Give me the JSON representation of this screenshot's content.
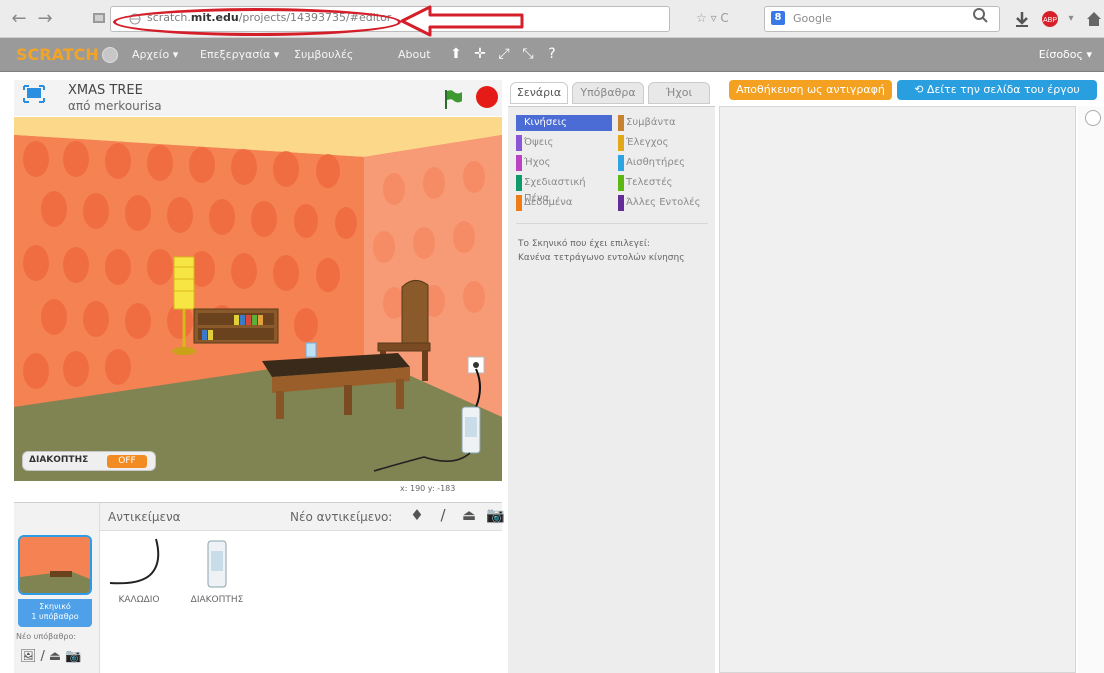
{
  "browser": {
    "url_prefix": "scratch.",
    "url_domain": "mit.edu",
    "url_suffix": "/projects/14393735/#editor",
    "search_engine": "Google"
  },
  "menubar": {
    "logo": "SCRATCH",
    "items": [
      "Αρχείο ▾",
      "Επεξεργασία ▾",
      "Συμβουλές",
      "About"
    ],
    "login": "Είσοδος ▾"
  },
  "stage": {
    "title": "XMAS TREE",
    "author": "από merkourisa",
    "variable_label": "ΔΙΑΚΟΠΤΗΣ",
    "variable_value": "OFF",
    "coords": "x: 190  y: -183"
  },
  "sprites": {
    "title": "Αντικείμενα",
    "new_sprite_label": "Νέο αντικείμενο:",
    "stage_thumb_label": "Σκηνικό\n1 υπόβαθρο",
    "new_backdrop_label": "Νέο υπόβαθρο:",
    "items": [
      {
        "name": "ΚΑΛΩΔΙΟ"
      },
      {
        "name": "ΔΙΑΚΟΠΤΗΣ"
      }
    ]
  },
  "tabs": [
    "Σενάρια",
    "Υπόβαθρα",
    "Ήχοι"
  ],
  "buttons": {
    "save_now": "Αποθήκευση ως αντιγραφή",
    "see_project_page": "Δείτε την σελίδα του έργου"
  },
  "palette": {
    "categories": [
      {
        "label": "Κινήσεις",
        "color": "#4a6cd4",
        "active": true
      },
      {
        "label": "Συμβάντα",
        "color": "#c88330"
      },
      {
        "label": "Όψεις",
        "color": "#8a55d7"
      },
      {
        "label": "Έλεγχος",
        "color": "#e1a91a"
      },
      {
        "label": "Ήχος",
        "color": "#bb42c3"
      },
      {
        "label": "Αισθητήρες",
        "color": "#2ca5e2"
      },
      {
        "label": "Σχεδιαστική Πένα",
        "color": "#0e9a6c"
      },
      {
        "label": "Τελεστές",
        "color": "#5cb712"
      },
      {
        "label": "Δεδομένα",
        "color": "#ee7d16"
      },
      {
        "label": "Άλλες Εντολές",
        "color": "#632d99"
      }
    ],
    "message_line1": "Το Σκηνικό που έχει επιλεγεί:",
    "message_line2": "Κανένα τετράγωνο εντολών κίνησης"
  }
}
